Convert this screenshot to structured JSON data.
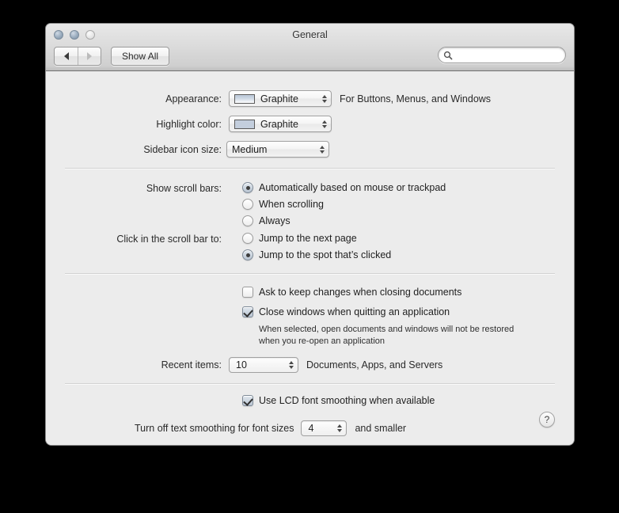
{
  "window": {
    "title": "General",
    "traffic_lights": [
      "close-button",
      "minimize-button",
      "zoom-button"
    ]
  },
  "toolbar": {
    "back_label": "back-arrow",
    "forward_label": "forward-arrow",
    "show_all_label": "Show All",
    "search": {
      "value": "",
      "placeholder": ""
    }
  },
  "appearance": {
    "label": "Appearance:",
    "value": "Graphite",
    "hint": "For Buttons, Menus, and Windows",
    "swatch_color": "#c3cedd"
  },
  "highlight": {
    "label": "Highlight color:",
    "value": "Graphite",
    "swatch_color": "#c3cedd"
  },
  "sidebar_icon_size": {
    "label": "Sidebar icon size:",
    "value": "Medium"
  },
  "scroll_bars": {
    "label": "Show scroll bars:",
    "options": [
      {
        "label": "Automatically based on mouse or trackpad",
        "selected": true
      },
      {
        "label": "When scrolling",
        "selected": false
      },
      {
        "label": "Always",
        "selected": false
      }
    ]
  },
  "scroll_click": {
    "label": "Click in the scroll bar to:",
    "options": [
      {
        "label": "Jump to the next page",
        "selected": false
      },
      {
        "label": "Jump to the spot that’s clicked",
        "selected": true
      }
    ]
  },
  "checkboxes": {
    "ask_keep_changes": {
      "label": "Ask to keep changes when closing documents",
      "checked": false
    },
    "close_windows": {
      "label": "Close windows when quitting an application",
      "checked": true,
      "help": "When selected, open documents and windows will not be restored when you re-open an application"
    },
    "lcd_smoothing": {
      "label": "Use LCD font smoothing when available",
      "checked": true
    }
  },
  "recent_items": {
    "label": "Recent items:",
    "value": "10",
    "suffix": "Documents, Apps, and Servers"
  },
  "text_smoothing": {
    "prefix": "Turn off text smoothing for font sizes",
    "value": "4",
    "suffix": "and smaller"
  },
  "help_button": {
    "label": "?"
  }
}
